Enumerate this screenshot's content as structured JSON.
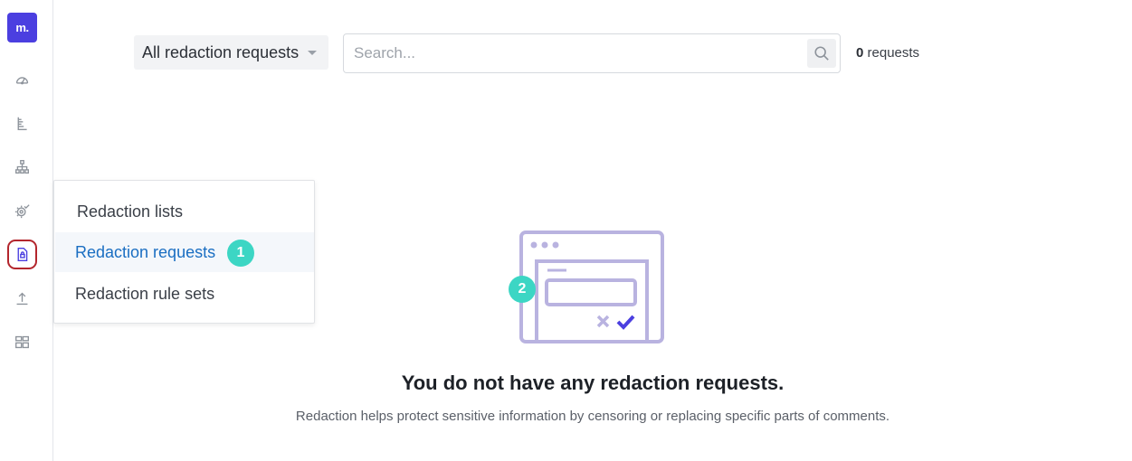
{
  "sidebar": {
    "logo_text": "m.",
    "items": [
      {
        "icon": "gauge-icon"
      },
      {
        "icon": "ruler-icon"
      },
      {
        "icon": "hierarchy-icon"
      },
      {
        "icon": "gear-check-icon"
      },
      {
        "icon": "redaction-document-icon",
        "active": true
      },
      {
        "icon": "upload-icon"
      },
      {
        "icon": "grid-layout-icon"
      }
    ]
  },
  "toolbar": {
    "filter_label": "All redaction requests",
    "search_placeholder": "Search...",
    "search_value": "",
    "count_value": "0",
    "count_suffix": " requests"
  },
  "menu": {
    "items": [
      {
        "label": "Redaction lists"
      },
      {
        "label": "Redaction requests",
        "selected": true
      },
      {
        "label": "Redaction rule sets"
      }
    ]
  },
  "annotations": {
    "badge_1": "1",
    "badge_2": "2"
  },
  "empty_state": {
    "title": "You do not have any redaction requests.",
    "description": "Redaction helps protect sensitive information by censoring or replacing specific parts of comments."
  },
  "colors": {
    "brand": "#4b3fe0",
    "link_active": "#1a6ec2",
    "badge": "#3cd6c4",
    "active_outline": "#b3262d",
    "illustration": "#b9b3e0"
  }
}
